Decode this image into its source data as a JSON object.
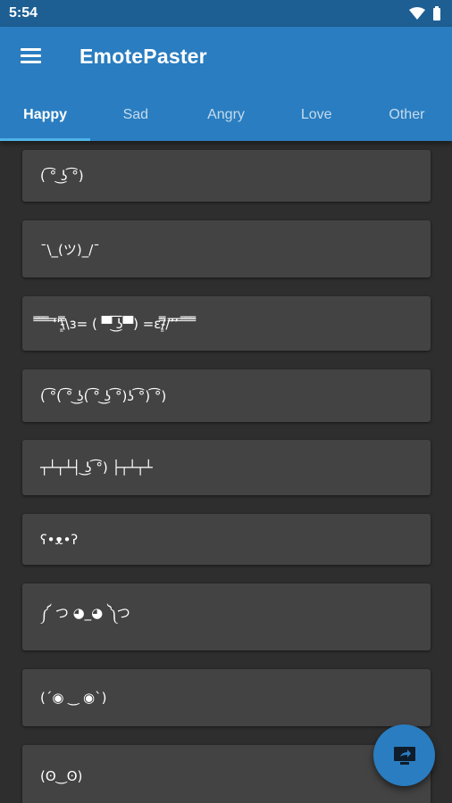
{
  "status_bar": {
    "time": "5:54",
    "icons": [
      "wifi-icon",
      "battery-icon"
    ]
  },
  "app": {
    "title": "EmotePaster",
    "menu_icon": "menu-icon"
  },
  "tabs": [
    {
      "label": "Happy",
      "active": true
    },
    {
      "label": "Sad",
      "active": false
    },
    {
      "label": "Angry",
      "active": false
    },
    {
      "label": "Love",
      "active": false
    },
    {
      "label": "Other",
      "active": false
    }
  ],
  "emotes": [
    "( ͡° ͜ʖ ͡°)",
    "¯\\_(ツ)_/¯",
    "̿̿ ̿̿ ̿̿ ̿'̿'\\̵͇̿̿\\з= ( ▀ ͜͞ʖ▀) =ε/̵͇̿̿/’̿’̿ ̿ ̿̿ ̿̿ ̿̿",
    "( ͡°( ͡° ͜ʖ( ͡° ͜ʖ ͡°)ʖ ͡°) ͡°)",
    "┬┴┬┴┤ ͜ʖ ͡°) ├┬┴┬┴",
    "ʕ•ᴥ•ʔ",
    "༼ つ ◕_◕ ༽つ",
    "(´◉ ‿ ◉`)",
    "(ʘ‿ʘ)"
  ],
  "fab": {
    "icon": "cast-icon"
  },
  "colors": {
    "primary": "#2a7dc0",
    "status_bar": "#1e5f93",
    "background": "#2e2e2e",
    "card": "#434343",
    "tab_indicator": "#4fb3e8"
  }
}
